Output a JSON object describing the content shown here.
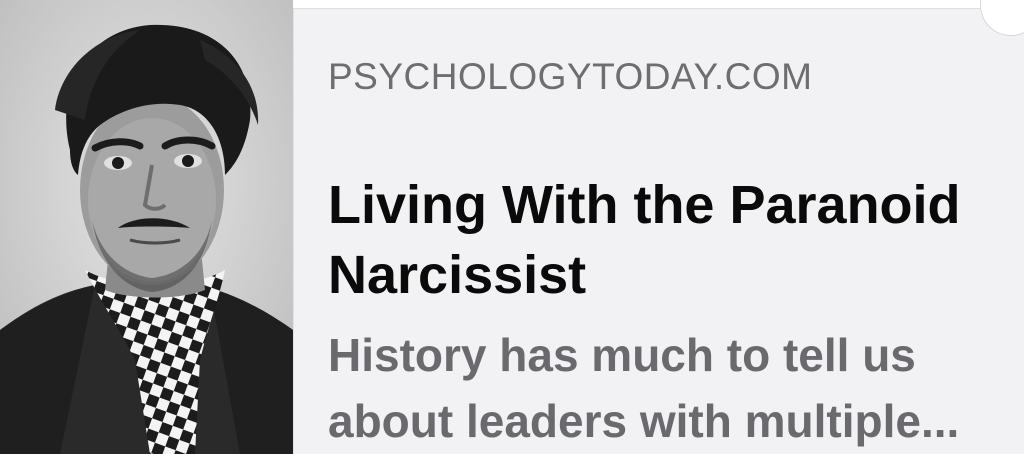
{
  "link_preview": {
    "source": "PSYCHOLOGYTODAY.COM",
    "title_lines": [
      "Living With the Paranoid",
      "Narcissist"
    ],
    "description_lines": [
      "History has much to tell us",
      "about leaders with multiple..."
    ],
    "thumbnail": {
      "alt": "black-and-white portrait photograph of a young man in a checkered scarf"
    }
  },
  "colors": {
    "background": "#f2f2f4",
    "title": "#0a0a0a",
    "source": "#6e6e72",
    "description": "#6a6a6e"
  }
}
